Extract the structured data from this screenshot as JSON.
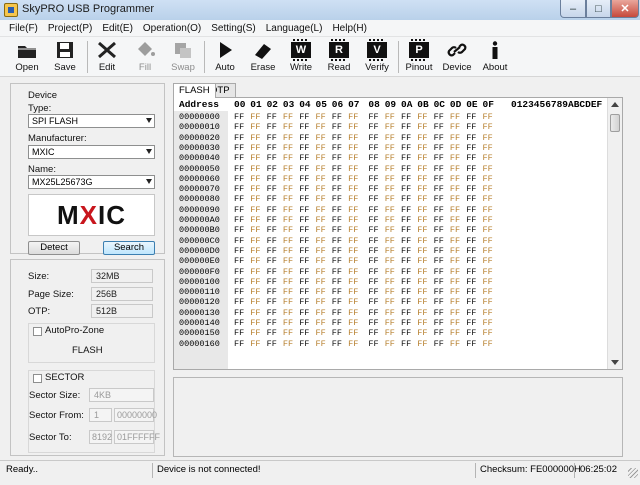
{
  "window": {
    "title": "SkyPRO USB Programmer"
  },
  "menu": [
    "File(F)",
    "Project(P)",
    "Edit(E)",
    "Operation(O)",
    "Setting(S)",
    "Language(L)",
    "Help(H)"
  ],
  "toolbar": {
    "open": "Open",
    "save": "Save",
    "edit": "Edit",
    "fill": "Fill",
    "swap": "Swap",
    "auto": "Auto",
    "erase": "Erase",
    "write": "Write",
    "read": "Read",
    "verify": "Verify",
    "pinout": "Pinout",
    "device": "Device",
    "about": "About",
    "write_chip": "W",
    "read_chip": "R",
    "verify_chip": "V",
    "pinout_chip": "P"
  },
  "device_panel": {
    "group_title": "Device",
    "type_label": "Type:",
    "type_value": "SPI FLASH",
    "manufacturer_label": "Manufacturer:",
    "manufacturer_value": "MXIC",
    "name_label": "Name:",
    "name_value": "MX25L25673G",
    "logo_text": "MXIC",
    "detect": "Detect",
    "search": "Search"
  },
  "info_panel": {
    "size_label": "Size:",
    "size_value": "32MB",
    "page_label": "Page Size:",
    "page_value": "256B",
    "otp_label": "OTP:",
    "otp_value": "512B",
    "autopro_label": "AutoPro-Zone",
    "flash_label": "FLASH",
    "sector_label": "SECTOR",
    "sector_size_label": "Sector Size:",
    "sector_size_value": "4KB",
    "sector_from_label": "Sector From:",
    "sector_from_a": "1",
    "sector_from_b": "00000000",
    "sector_to_label": "Sector To:",
    "sector_to_a": "8192",
    "sector_to_b": "01FFFFFF"
  },
  "tabs": [
    "FLASH",
    "OTP"
  ],
  "hex": {
    "header_address": "Address",
    "columns": [
      "00",
      "01",
      "02",
      "03",
      "04",
      "05",
      "06",
      "07",
      "08",
      "09",
      "0A",
      "0B",
      "0C",
      "0D",
      "0E",
      "0F"
    ],
    "ascii_header": "0123456789ABCDEF",
    "rows": [
      "00000000",
      "00000010",
      "00000020",
      "00000030",
      "00000040",
      "00000050",
      "00000060",
      "00000070",
      "00000080",
      "00000090",
      "000000A0",
      "000000B0",
      "000000C0",
      "000000D0",
      "000000E0",
      "000000F0",
      "00000100",
      "00000110",
      "00000120",
      "00000130",
      "00000140",
      "00000150",
      "00000160"
    ],
    "byte": "FF"
  },
  "status": {
    "ready": "Ready..",
    "connection": "Device is not connected!",
    "checksum": "Checksum: FE000000H",
    "time": "06:25:02"
  },
  "colors": {
    "byte_even": "#111111",
    "byte_odd": "#b7802f",
    "logo_accent": "#c8161d"
  }
}
